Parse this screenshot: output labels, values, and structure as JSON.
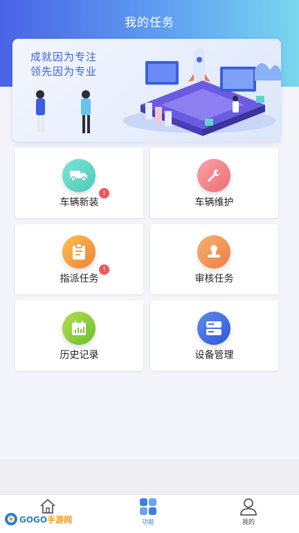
{
  "header": {
    "title": "我的任务"
  },
  "banner": {
    "line1": "成就因为专注",
    "line2": "领先因为专业"
  },
  "cards": [
    {
      "label": "车辆新装",
      "badge": "!",
      "icon": "truck-icon",
      "color": "#5fd6c9"
    },
    {
      "label": "车辆维护",
      "icon": "wrench-icon",
      "color": "#f27f86"
    },
    {
      "label": "指派任务",
      "badge": "!",
      "icon": "clipboard-icon",
      "color": "#f6a23a"
    },
    {
      "label": "审核任务",
      "icon": "stamp-icon",
      "color": "#f0955b"
    },
    {
      "label": "历史记录",
      "icon": "calendar-chart-icon",
      "color": "#8fcb3c"
    },
    {
      "label": "设备管理",
      "icon": "server-icon",
      "color": "#3e6fe0"
    }
  ],
  "tabbar": {
    "tabs": [
      {
        "label": "",
        "icon": "home-icon"
      },
      {
        "label": "功能",
        "icon": "grid-icon",
        "active": true
      },
      {
        "label": "我的",
        "icon": "user-icon"
      }
    ]
  },
  "watermark": {
    "brand": "GOGO",
    "suffix": "手游网"
  }
}
